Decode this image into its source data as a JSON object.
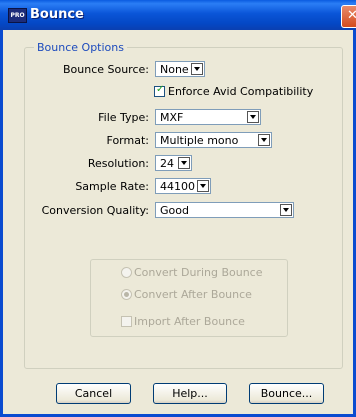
{
  "window": {
    "title": "Bounce",
    "app_icon_text": "PRO",
    "close_symbol": "✕"
  },
  "group": {
    "title": "Bounce Options",
    "bounce_source": {
      "label": "Bounce Source:",
      "value": "None"
    },
    "enforce_avid": {
      "label": "Enforce Avid Compatibility",
      "checked": true
    },
    "file_type": {
      "label": "File Type:",
      "value": "MXF"
    },
    "format": {
      "label": "Format:",
      "value": "Multiple mono"
    },
    "resolution": {
      "label": "Resolution:",
      "value": "24"
    },
    "sample_rate": {
      "label": "Sample Rate:",
      "value": "44100"
    },
    "conversion_quality": {
      "label": "Conversion Quality:",
      "value": "Good"
    },
    "convert_options": {
      "during_label": "Convert During Bounce",
      "after_label": "Convert After Bounce",
      "import_label": "Import After Bounce"
    }
  },
  "buttons": {
    "cancel": "Cancel",
    "help": "Help...",
    "bounce": "Bounce..."
  },
  "colors": {
    "titlebar": "#0a55d8",
    "group_title": "#1d4bbd",
    "dialog_bg": "#ece9d8"
  }
}
